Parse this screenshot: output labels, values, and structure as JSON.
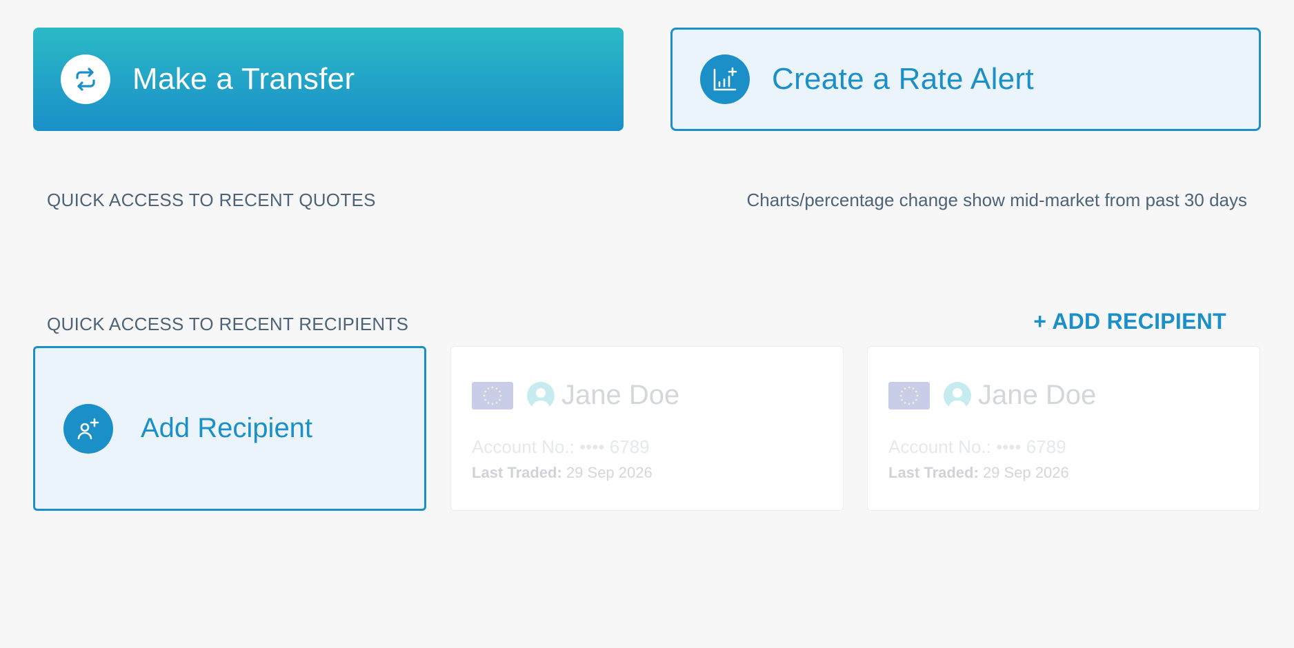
{
  "actions": {
    "transfer": {
      "label": "Make a Transfer",
      "icon": "transfer-arrows-icon"
    },
    "rate_alert": {
      "label": "Create a Rate Alert",
      "icon": "chart-plus-icon"
    }
  },
  "quotes": {
    "title": "QUICK ACCESS TO RECENT QUOTES",
    "note": "Charts/percentage change show mid-market from past 30 days"
  },
  "recipients": {
    "title": "QUICK ACCESS TO RECENT RECIPIENTS",
    "add_link": "+ ADD RECIPIENT",
    "add_card_label": "Add Recipient",
    "add_card_icon": "add-user-icon",
    "items": [
      {
        "name": "Jane Doe",
        "flag": "eu-flag-icon",
        "account": "Account No.: •••• 6789",
        "last_traded_label": "Last Traded:",
        "last_traded_value": "29 Sep 2026"
      },
      {
        "name": "Jane Doe",
        "flag": "eu-flag-icon",
        "account": "Account No.: •••• 6789",
        "last_traded_label": "Last Traded:",
        "last_traded_value": "29 Sep 2026"
      }
    ]
  },
  "colors": {
    "brand": "#1a8fc8",
    "teal": "#2bb9c6",
    "background": "#f7f7f7",
    "section_text": "#4c6378"
  }
}
